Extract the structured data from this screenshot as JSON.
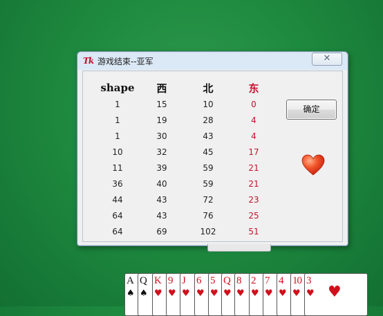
{
  "dialog": {
    "icon_text": "Tk",
    "title": "游戏结束--亚军",
    "close_glyph": "✕",
    "ok_label": "确定"
  },
  "scores": {
    "headers": [
      "shape",
      "西",
      "北",
      "东"
    ],
    "rows": [
      [
        "1",
        "15",
        "10",
        "0"
      ],
      [
        "1",
        "19",
        "28",
        "4"
      ],
      [
        "1",
        "30",
        "43",
        "4"
      ],
      [
        "10",
        "32",
        "45",
        "17"
      ],
      [
        "11",
        "39",
        "59",
        "21"
      ],
      [
        "36",
        "40",
        "59",
        "21"
      ],
      [
        "44",
        "43",
        "72",
        "23"
      ],
      [
        "64",
        "43",
        "76",
        "25"
      ],
      [
        "64",
        "69",
        "102",
        "51"
      ]
    ]
  },
  "heart_icon": "heart-icon",
  "colors": {
    "felt": "#1e8a3f",
    "east_text": "#c8102e",
    "dialog_bg": "#f0f0f0"
  },
  "hand": {
    "cards": [
      {
        "rank": "A",
        "suit": "♠",
        "color": "black"
      },
      {
        "rank": "Q",
        "suit": "♠",
        "color": "black"
      },
      {
        "rank": "K",
        "suit": "♥",
        "color": "red"
      },
      {
        "rank": "9",
        "suit": "♥",
        "color": "red"
      },
      {
        "rank": "J",
        "suit": "♥",
        "color": "red"
      },
      {
        "rank": "6",
        "suit": "♥",
        "color": "red"
      },
      {
        "rank": "5",
        "suit": "♥",
        "color": "red"
      },
      {
        "rank": "Q",
        "suit": "♥",
        "color": "red"
      },
      {
        "rank": "8",
        "suit": "♥",
        "color": "red"
      },
      {
        "rank": "2",
        "suit": "♥",
        "color": "red"
      },
      {
        "rank": "7",
        "suit": "♥",
        "color": "red"
      },
      {
        "rank": "4",
        "suit": "♥",
        "color": "red"
      },
      {
        "rank": "10",
        "suit": "♥",
        "color": "red"
      },
      {
        "rank": "3",
        "suit": "♥",
        "color": "red"
      }
    ],
    "last_card_center_suit": "♥"
  }
}
